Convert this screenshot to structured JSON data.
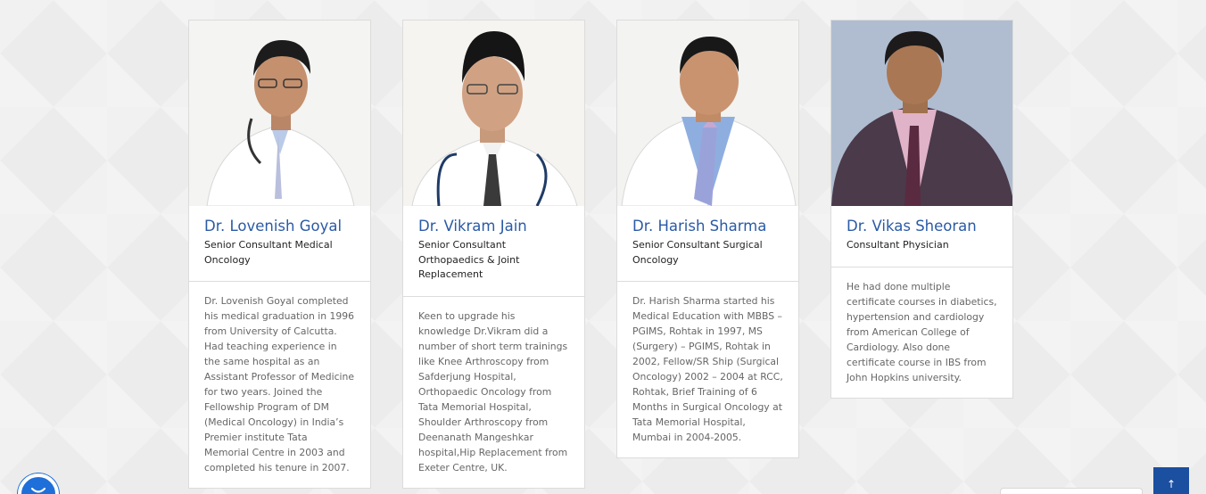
{
  "doctors": [
    {
      "name": "Dr. Lovenish Goyal",
      "role": "Senior Consultant Medical Oncology",
      "bio": "Dr. Lovenish Goyal completed his medical graduation in 1996 from University of Calcutta. Had teaching experience in the same hospital as an Assistant Professor of Medicine for two years. Joined the Fellowship Program of DM (Medical Oncology) in India’s Premier institute Tata Memorial Centre in 2003 and completed his tenure in 2007."
    },
    {
      "name": "Dr. Vikram Jain",
      "role": "Senior Consultant Orthopaedics & Joint Replacement",
      "bio": "Keen to upgrade his knowledge Dr.Vikram did a number of short term trainings like Knee Arthroscopy from Safderjung Hospital, Orthopaedic Oncology from Tata Memorial Hospital, Shoulder Arthroscopy from Deenanath Mangeshkar hospital,Hip Replacement from Exeter Centre, UK."
    },
    {
      "name": "Dr. Harish Sharma",
      "role": "Senior Consultant Surgical Oncology",
      "bio": "Dr. Harish Sharma started his Medical Education with MBBS – PGIMS, Rohtak in 1997, MS (Surgery) – PGIMS, Rohtak in 2002, Fellow/SR Ship (Surgical Oncology) 2002 – 2004 at RCC, Rohtak, Brief Training of 6 Months in Surgical Oncology at Tata Memorial Hospital, Mumbai in 2004-2005."
    },
    {
      "name": "Dr. Vikas Sheoran",
      "role": "Consultant Physician",
      "bio": "He had done multiple certificate courses in diabetics, hypertension and cardiology from American College of Cardiology. Also done certificate course in IBS from John Hopkins university."
    }
  ],
  "icons": {
    "chat": "chat-bubble-icon",
    "scroll_top": "arrow-up-icon"
  },
  "scroll_top_glyph": "↑",
  "colors": {
    "accent": "#2a5aa6",
    "chat": "#1e6fd9",
    "scroll_top": "#1b4fa0"
  }
}
